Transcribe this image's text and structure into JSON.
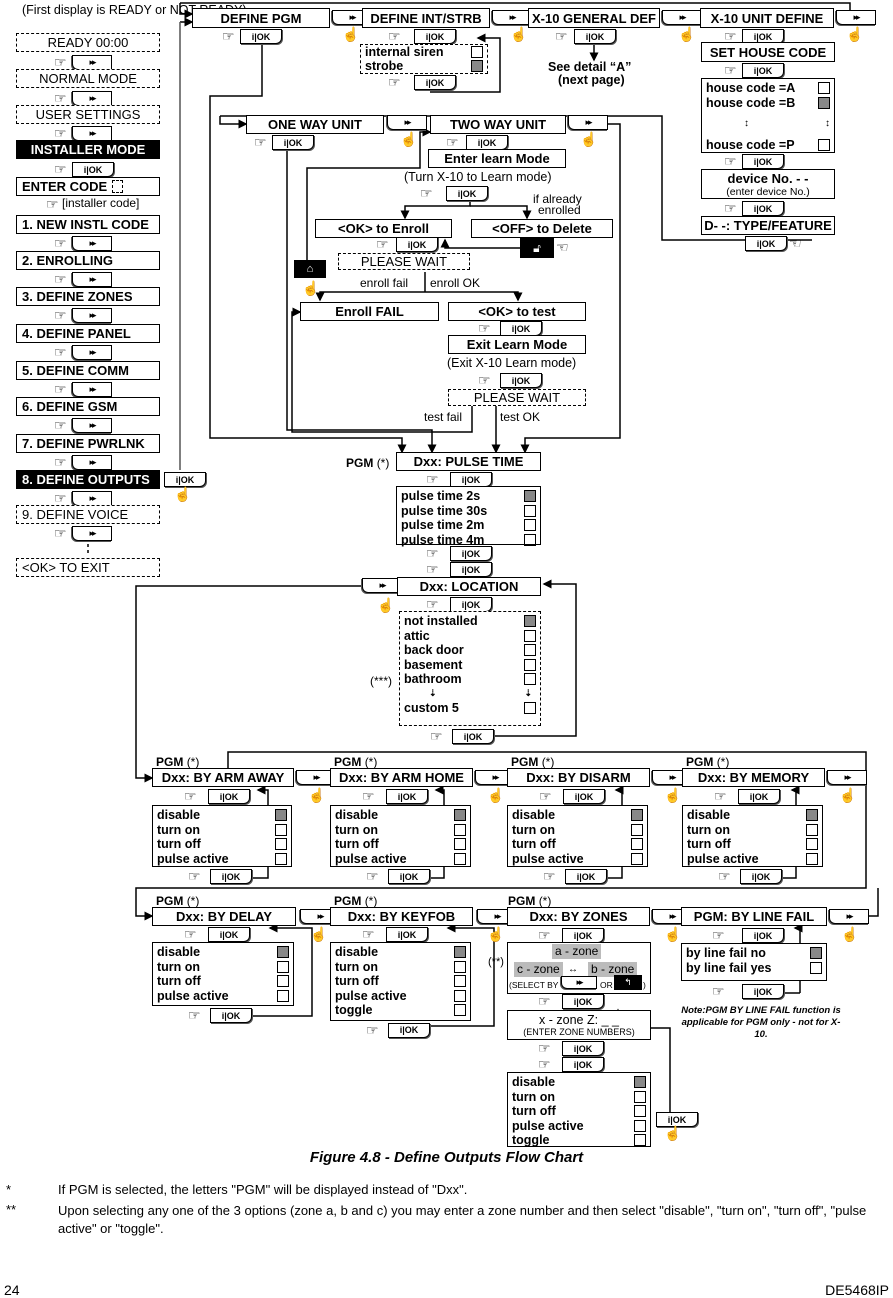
{
  "figure_caption": "Figure 4.8 - Define Outputs Flow Chart",
  "footnotes": [
    {
      "mark": "*",
      "text": "If PGM is selected, the letters \"PGM\" will be displayed instead of \"Dxx\"."
    },
    {
      "mark": "**",
      "text": "Upon selecting any one of the 3 options (zone a, b and c) you may enter a zone number and then select \"disable\", \"turn on\", \"turn off\", \"pulse active\" or \"toggle\"."
    }
  ],
  "page_number": "24",
  "doc_code": "DE5468IP",
  "buttons": {
    "ok": "i|OK",
    "next": "▸▸",
    "hand": "☞",
    "press": "☝"
  },
  "main_menu": {
    "first_note": "(First display is READY or NOT READY)",
    "ready": "READY 00:00",
    "normal": "NORMAL MODE",
    "user_settings": "USER SETTINGS",
    "installer_mode": "INSTALLER MODE",
    "enter_code": "ENTER CODE",
    "installer_code": "[installer code]",
    "items": [
      "1. NEW INSTL CODE",
      "2. ENROLLING",
      "3. DEFINE ZONES",
      "4. DEFINE PANEL",
      "5. DEFINE COMM",
      "6. DEFINE GSM",
      "7. DEFINE PWRLNK",
      "8. DEFINE OUTPUTS",
      "9. DEFINE VOICE"
    ],
    "exit": "<OK> TO EXIT"
  },
  "top_row": {
    "define_pgm": "DEFINE PGM",
    "define_int_strb": "DEFINE INT/STRB",
    "x10_general": "X-10 GENERAL DEF",
    "x10_unit": "X-10 UNIT DEFINE",
    "int_strb_options": [
      {
        "label": "internal siren",
        "selected": false
      },
      {
        "label": "strobe",
        "selected": true
      }
    ],
    "see_detail": "See detail “A”",
    "next_page": "(next page)"
  },
  "x10_unit": {
    "set_house_code": "SET HOUSE CODE",
    "house_codes": [
      {
        "label": "house code =A",
        "selected": false
      },
      {
        "label": "house code =B",
        "selected": true
      },
      {
        "label": "house code =P",
        "selected": false
      }
    ],
    "device_no": "device No.    - -",
    "device_hint": "(enter device No.)",
    "type_feature": "D- -: TYPE/FEATURE"
  },
  "learn": {
    "one_way": "ONE WAY UNIT",
    "two_way": "TWO WAY UNIT",
    "enter_learn": "Enter learn Mode",
    "turn_x10": "(Turn X-10 to Learn mode)",
    "if_already": "if already",
    "enrolled": "enrolled",
    "ok_enroll": "<OK> to Enroll",
    "off_delete": "<OFF> to Delete",
    "please_wait": "PLEASE WAIT",
    "enroll_fail_lbl": "enroll fail",
    "enroll_ok_lbl": "enroll OK",
    "enroll_fail": "Enroll FAIL",
    "ok_test": "<OK> to test",
    "exit_learn": "Exit Learn Mode",
    "exit_x10": "(Exit X-10 Learn mode)",
    "please_wait2": "PLEASE WAIT",
    "test_fail": "test fail",
    "test_ok": "test OK"
  },
  "pulse_time": {
    "prefix": "PGM",
    "asterisk": "(*)",
    "title": "Dxx: PULSE TIME",
    "options": [
      {
        "label": "pulse time 2s",
        "selected": true
      },
      {
        "label": "pulse time 30s",
        "selected": false
      },
      {
        "label": "pulse time 2m",
        "selected": false
      },
      {
        "label": "pulse time 4m",
        "selected": false
      }
    ]
  },
  "location": {
    "title": "Dxx: LOCATION",
    "note": "(***)",
    "options": [
      {
        "label": "not installed",
        "selected": true
      },
      {
        "label": "attic",
        "selected": false
      },
      {
        "label": "back door",
        "selected": false
      },
      {
        "label": "basement",
        "selected": false
      },
      {
        "label": "bathroom",
        "selected": false
      }
    ],
    "last": {
      "label": "custom 5",
      "selected": false
    }
  },
  "triggers_row1": [
    {
      "title": "Dxx: BY ARM AWAY",
      "options": [
        "disable",
        "turn on",
        "turn off",
        "pulse active"
      ]
    },
    {
      "title": "Dxx: BY ARM HOME",
      "options": [
        "disable",
        "turn on",
        "turn off",
        "pulse active"
      ]
    },
    {
      "title": "Dxx: BY DISARM",
      "options": [
        "disable",
        "turn on",
        "turn off",
        "pulse active"
      ]
    },
    {
      "title": "Dxx: BY MEMORY",
      "options": [
        "disable",
        "turn on",
        "turn off",
        "pulse active"
      ]
    }
  ],
  "triggers_row2": [
    {
      "title": "Dxx: BY DELAY",
      "options": [
        "disable",
        "turn on",
        "turn off",
        "pulse active"
      ]
    },
    {
      "title": "Dxx: BY KEYFOB",
      "options": [
        "disable",
        "turn on",
        "turn off",
        "pulse active",
        "toggle"
      ]
    }
  ],
  "pgm_label": "PGM",
  "pgm_ast": "(*)",
  "zones": {
    "title": "Dxx: BY ZONES",
    "a_zone": "a - zone",
    "b_zone": "b - zone",
    "c_zone": "c - zone",
    "select_by": "(SELECT BY",
    "or": "OR",
    "close": ")",
    "note": "(**)",
    "x_zone": "x - zone     Z: _ _",
    "enter_numbers": "(ENTER ZONE NUMBERS)",
    "options": [
      "disable",
      "turn on",
      "turn off",
      "pulse active",
      "toggle"
    ]
  },
  "line_fail": {
    "title": "PGM: BY LINE FAIL",
    "options": [
      {
        "label": "by line fail no",
        "selected": true
      },
      {
        "label": "by line fail yes",
        "selected": false
      }
    ],
    "note": "Note:PGM BY LINE FAIL function is applicable for PGM only - not for X-10."
  }
}
